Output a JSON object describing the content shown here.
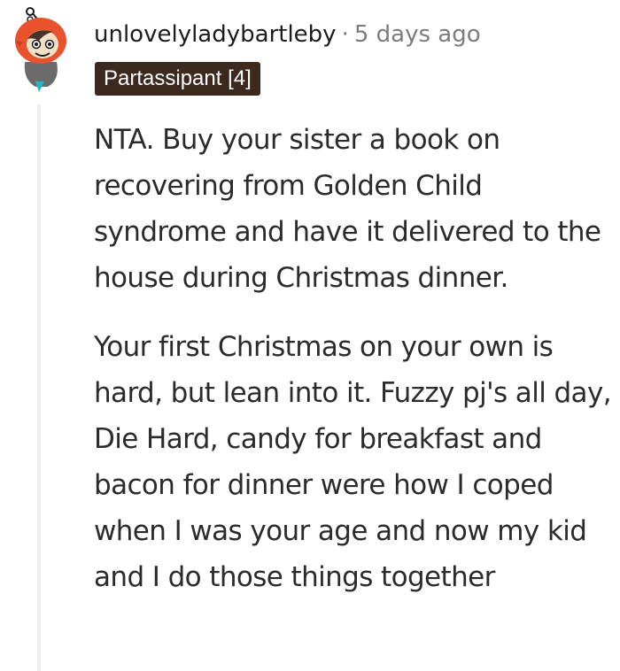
{
  "comment": {
    "username": "unlovelyladybartleby",
    "separator": "·",
    "age": "5 days ago",
    "flair": "Partassipant [4]",
    "paragraphs": [
      "NTA. Buy your sister a book on recovering from Golden Child syndrome and have it delivered to the house during Christmas dinner.",
      "Your first Christmas on your own is hard, but lean into it. Fuzzy pj's all day, Die Hard, candy for breakfast and bacon for dinner were how I coped when I was your age and now my kid and I do those things together"
    ]
  },
  "colors": {
    "flair_bg": "#3d2a1f",
    "avatar_hood": "#e8532d",
    "meta_text": "#7c7c7c"
  },
  "icons": {
    "avatar": "snoo-avatar-orange-hood"
  }
}
